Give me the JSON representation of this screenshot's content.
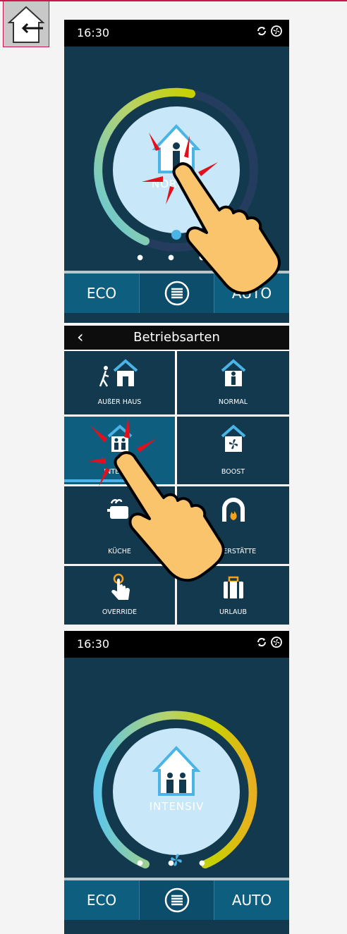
{
  "screen1": {
    "status": {
      "time": "16:30",
      "icons": [
        "sync-icon",
        "fan-icon"
      ]
    },
    "mode_label": "NORMAL",
    "dots": "● ● ●",
    "bottom": {
      "eco": "ECO",
      "auto": "AUTO"
    }
  },
  "menu": {
    "title": "Betriebsarten",
    "back": "‹",
    "tiles": [
      {
        "label": "AUßER HAUS",
        "icon": "away-house-icon"
      },
      {
        "label": "NORMAL",
        "icon": "normal-house-icon"
      },
      {
        "label": "INTENSIV",
        "icon": "intensive-house-icon",
        "active": true
      },
      {
        "label": "BOOST",
        "icon": "boost-fan-house-icon"
      },
      {
        "label": "KÜCHE",
        "icon": "kitchen-icon"
      },
      {
        "label": "FEUERSTÄTTE",
        "icon": "fireplace-icon"
      },
      {
        "label": "OVERRIDE",
        "icon": "override-hand-icon"
      },
      {
        "label": "URLAUB",
        "icon": "suitcase-icon"
      }
    ]
  },
  "screen2": {
    "status": {
      "time": "16:30",
      "icons": [
        "sync-icon",
        "fan-icon"
      ]
    },
    "mode_label": "INTENSIV",
    "dots": "● ● ●",
    "bottom": {
      "eco": "ECO",
      "auto": "AUTO"
    }
  },
  "colors": {
    "accent": "#c8174e",
    "screen_bg": "#13394f",
    "bottom_bar": "#0e5e7f",
    "highlight": "#4ab4e6",
    "hand": "#f9c46b",
    "tap_marks": "#e3101c"
  }
}
